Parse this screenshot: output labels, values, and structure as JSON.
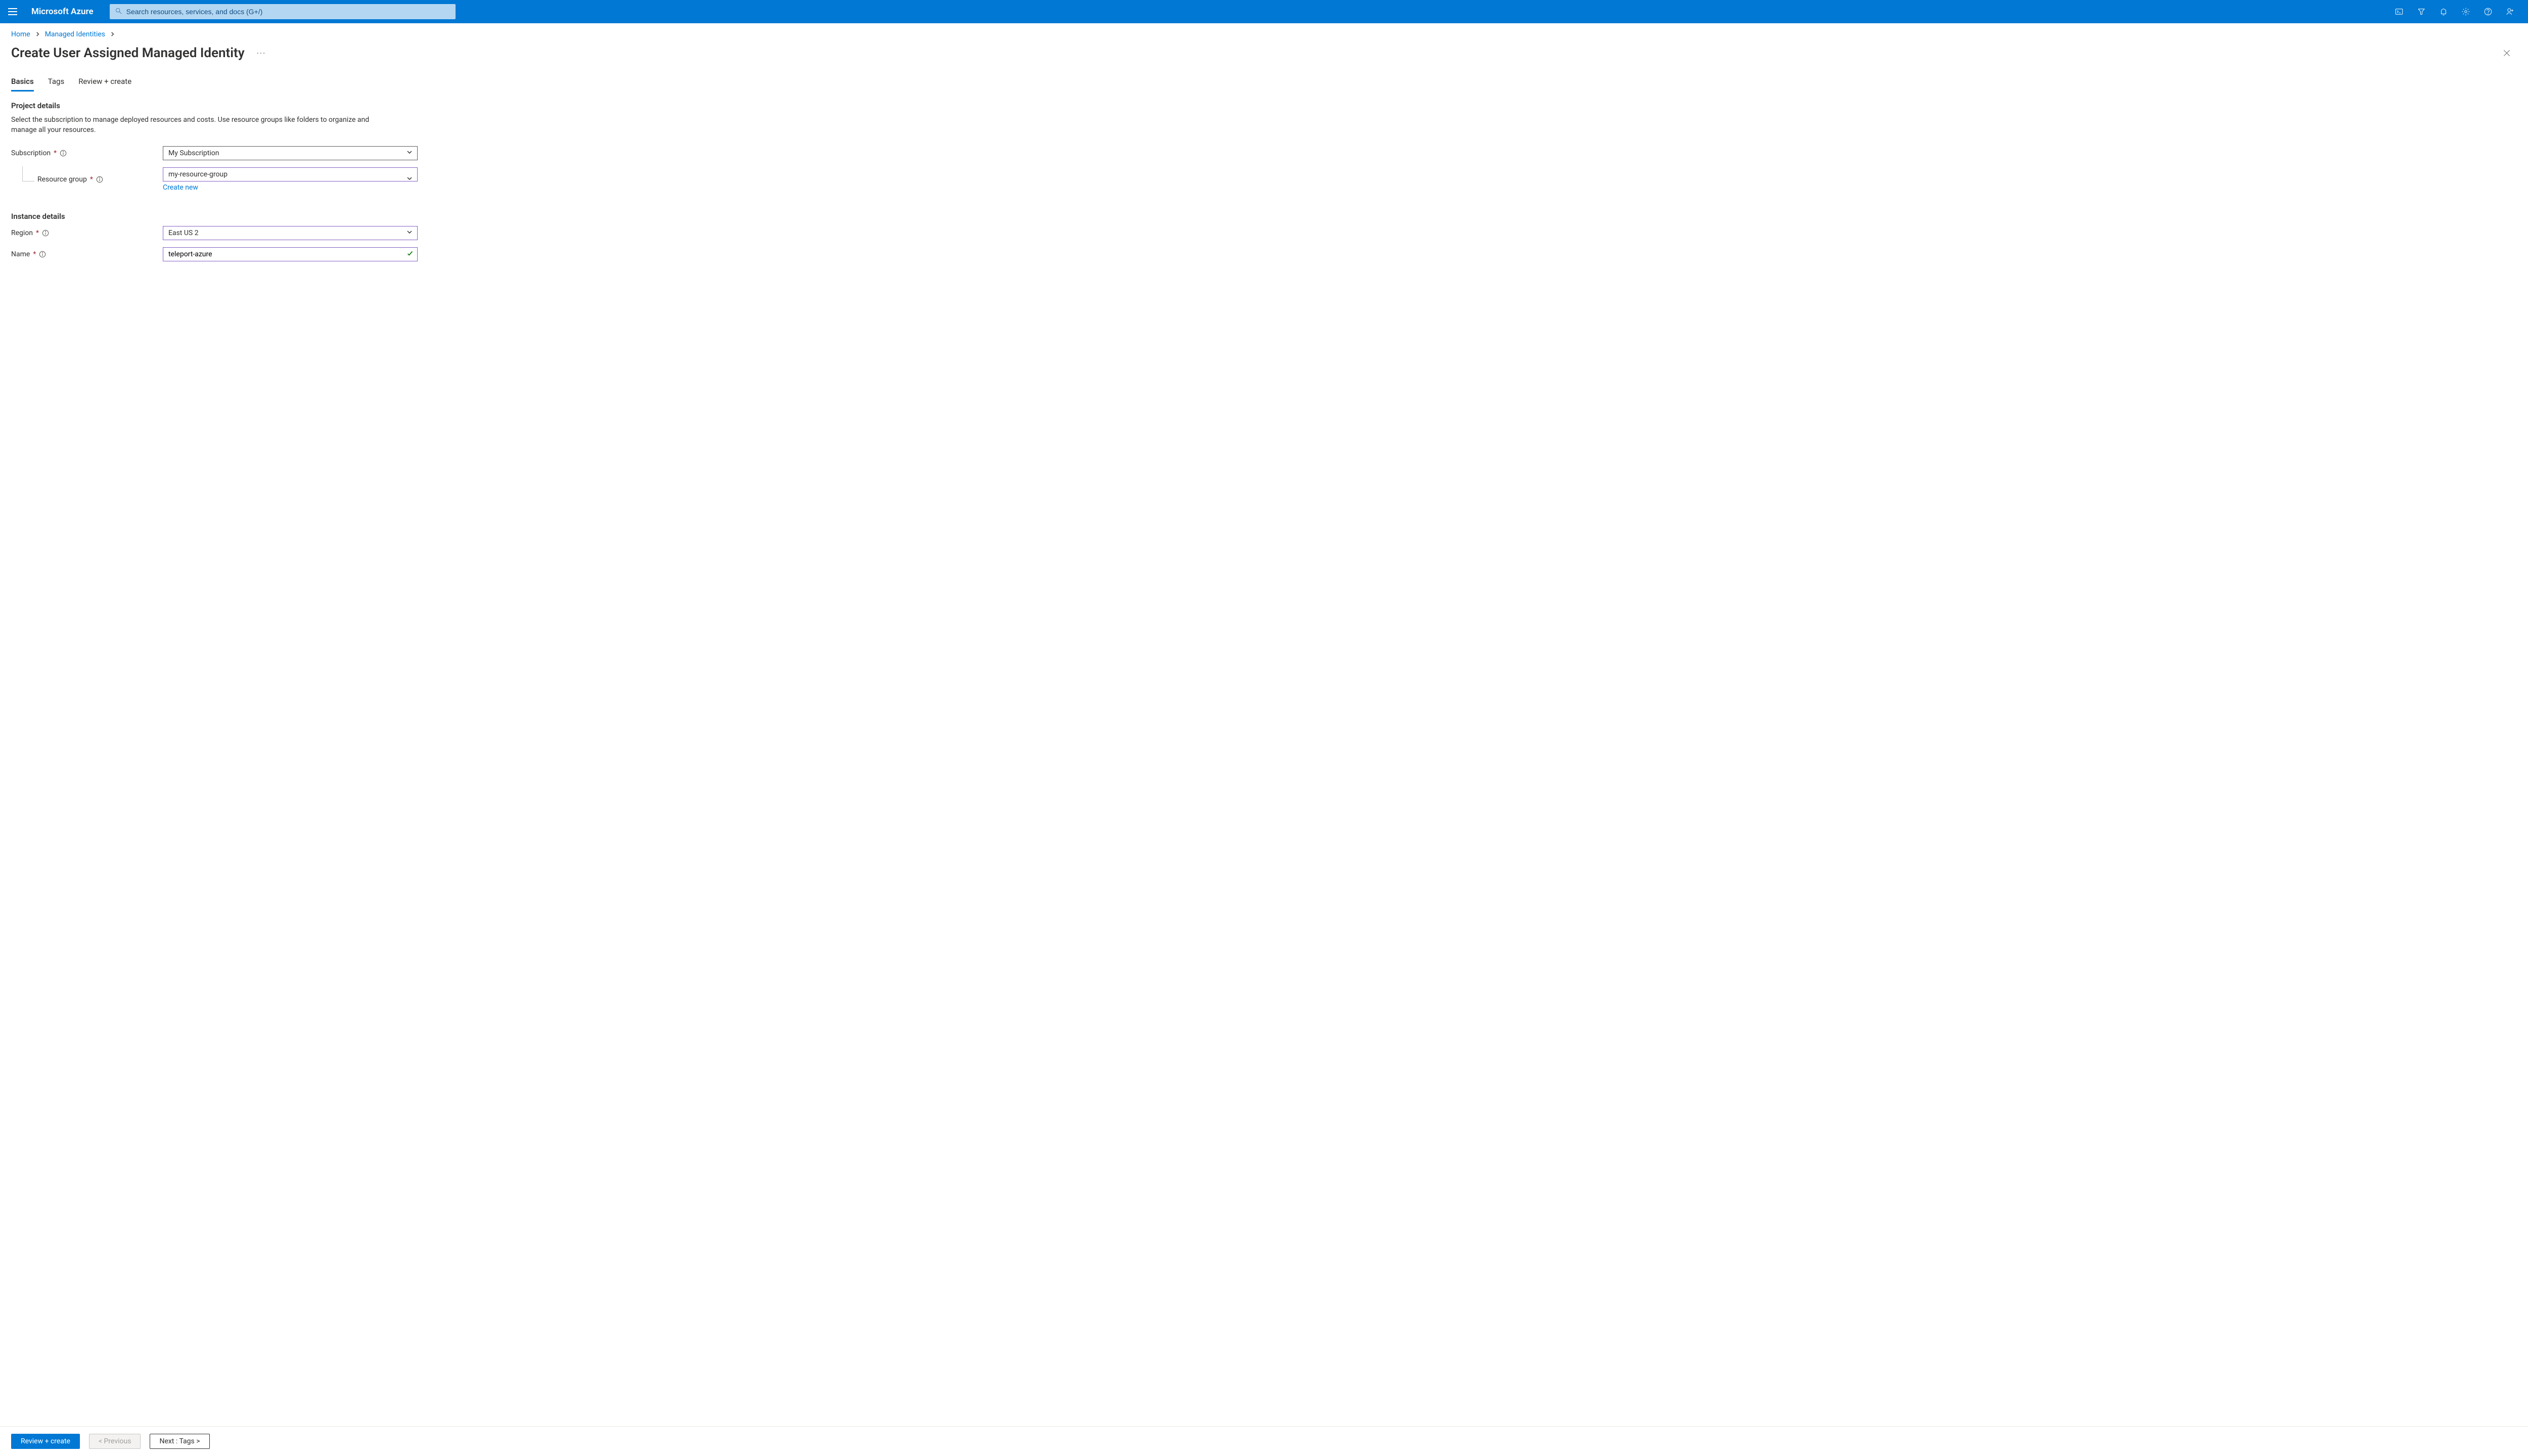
{
  "topbar": {
    "brand": "Microsoft Azure",
    "search_placeholder": "Search resources, services, and docs (G+/)"
  },
  "breadcrumb": {
    "items": [
      {
        "label": "Home"
      },
      {
        "label": "Managed Identities"
      }
    ]
  },
  "page": {
    "title": "Create User Assigned Managed Identity"
  },
  "tabs": [
    {
      "label": "Basics",
      "active": true
    },
    {
      "label": "Tags",
      "active": false
    },
    {
      "label": "Review + create",
      "active": false
    }
  ],
  "sections": {
    "project": {
      "heading": "Project details",
      "description": "Select the subscription to manage deployed resources and costs. Use resource groups like folders to organize and manage all your resources."
    },
    "instance": {
      "heading": "Instance details"
    }
  },
  "fields": {
    "subscription": {
      "label": "Subscription",
      "value": "My Subscription"
    },
    "resource_group": {
      "label": "Resource group",
      "value": "my-resource-group",
      "create_new": "Create new"
    },
    "region": {
      "label": "Region",
      "value": "East US 2"
    },
    "name": {
      "label": "Name",
      "value": "teleport-azure"
    }
  },
  "footer": {
    "review": "Review + create",
    "previous": "< Previous",
    "next": "Next : Tags >"
  }
}
